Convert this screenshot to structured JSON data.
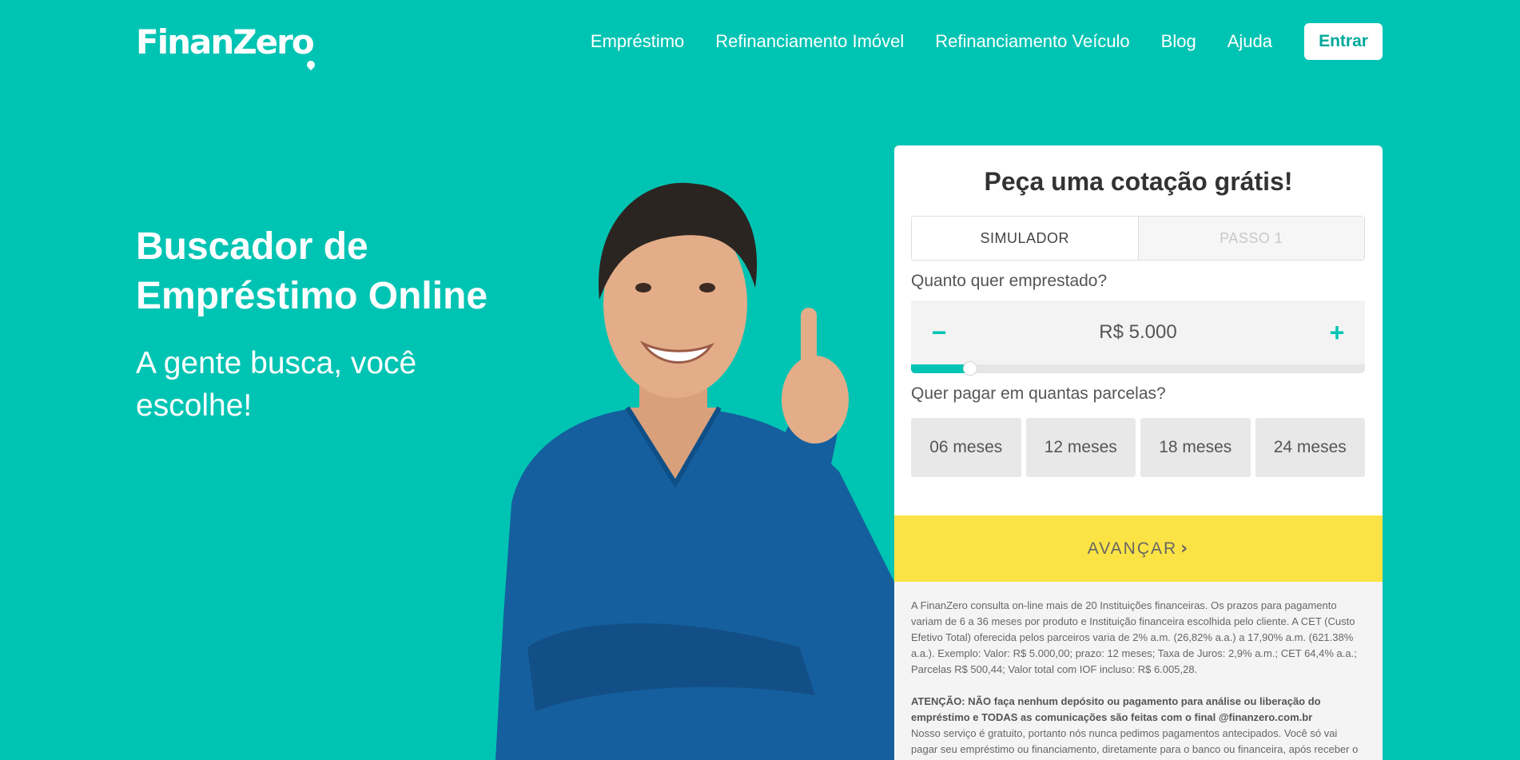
{
  "header": {
    "logo": "FinanZero",
    "nav": [
      {
        "label": "Empréstimo"
      },
      {
        "label": "Refinanciamento Imóvel"
      },
      {
        "label": "Refinanciamento Veículo"
      },
      {
        "label": "Blog"
      },
      {
        "label": "Ajuda"
      }
    ],
    "login_label": "Entrar"
  },
  "hero": {
    "title": "Buscador de Empréstimo Online",
    "subtitle": "A gente busca, você escolhe!"
  },
  "colors": {
    "brand_teal": "#00c4b3",
    "cta_yellow": "#fbe345",
    "person_sweater": "#155f9e"
  },
  "quote_form": {
    "title": "Peça uma cotação grátis!",
    "tabs": [
      {
        "label": "SIMULADOR",
        "active": true
      },
      {
        "label": "PASSO 1",
        "active": false
      }
    ],
    "amount_label": "Quanto quer emprestado?",
    "amount_value": "R$ 5.000",
    "minus_symbol": "−",
    "plus_symbol": "+",
    "slider_fraction": 0.13,
    "installments_label": "Quer pagar em quantas parcelas?",
    "installments": [
      {
        "label": "06 meses"
      },
      {
        "label": "12 meses"
      },
      {
        "label": "18 meses"
      },
      {
        "label": "24 meses"
      }
    ],
    "advance_label": "AVANÇAR",
    "advance_icon": "chevron-right-icon"
  },
  "disclaimer": {
    "text": "A FinanZero consulta on-line mais de 20 Instituições financeiras. Os prazos para pagamento variam de 6 a 36 meses por produto e Instituição financeira escolhida pelo cliente. A CET (Custo Efetivo Total) oferecida pelos parceiros varia de 2% a.m. (26,82% a.a.) a 17,90% a.m. (621.38% a.a.). Exemplo: Valor: R$ 5.000,00; prazo: 12 meses; Taxa de Juros: 2,9% a.m.; CET 64,4% a.a.; Parcelas R$ 500,44; Valor total com IOF incluso: R$ 6.005,28.",
    "warning": "ATENÇÃO: NÃO faça nenhum depósito ou pagamento para análise ou liberação do empréstimo e TODAS as comunicações são feitas com o final @finanzero.com.br",
    "note": "Nosso serviço é gratuito, portanto nós nunca pedimos pagamentos antecipados. Você só vai pagar seu empréstimo ou financiamento, diretamente para o banco ou financeira, após receber o"
  }
}
